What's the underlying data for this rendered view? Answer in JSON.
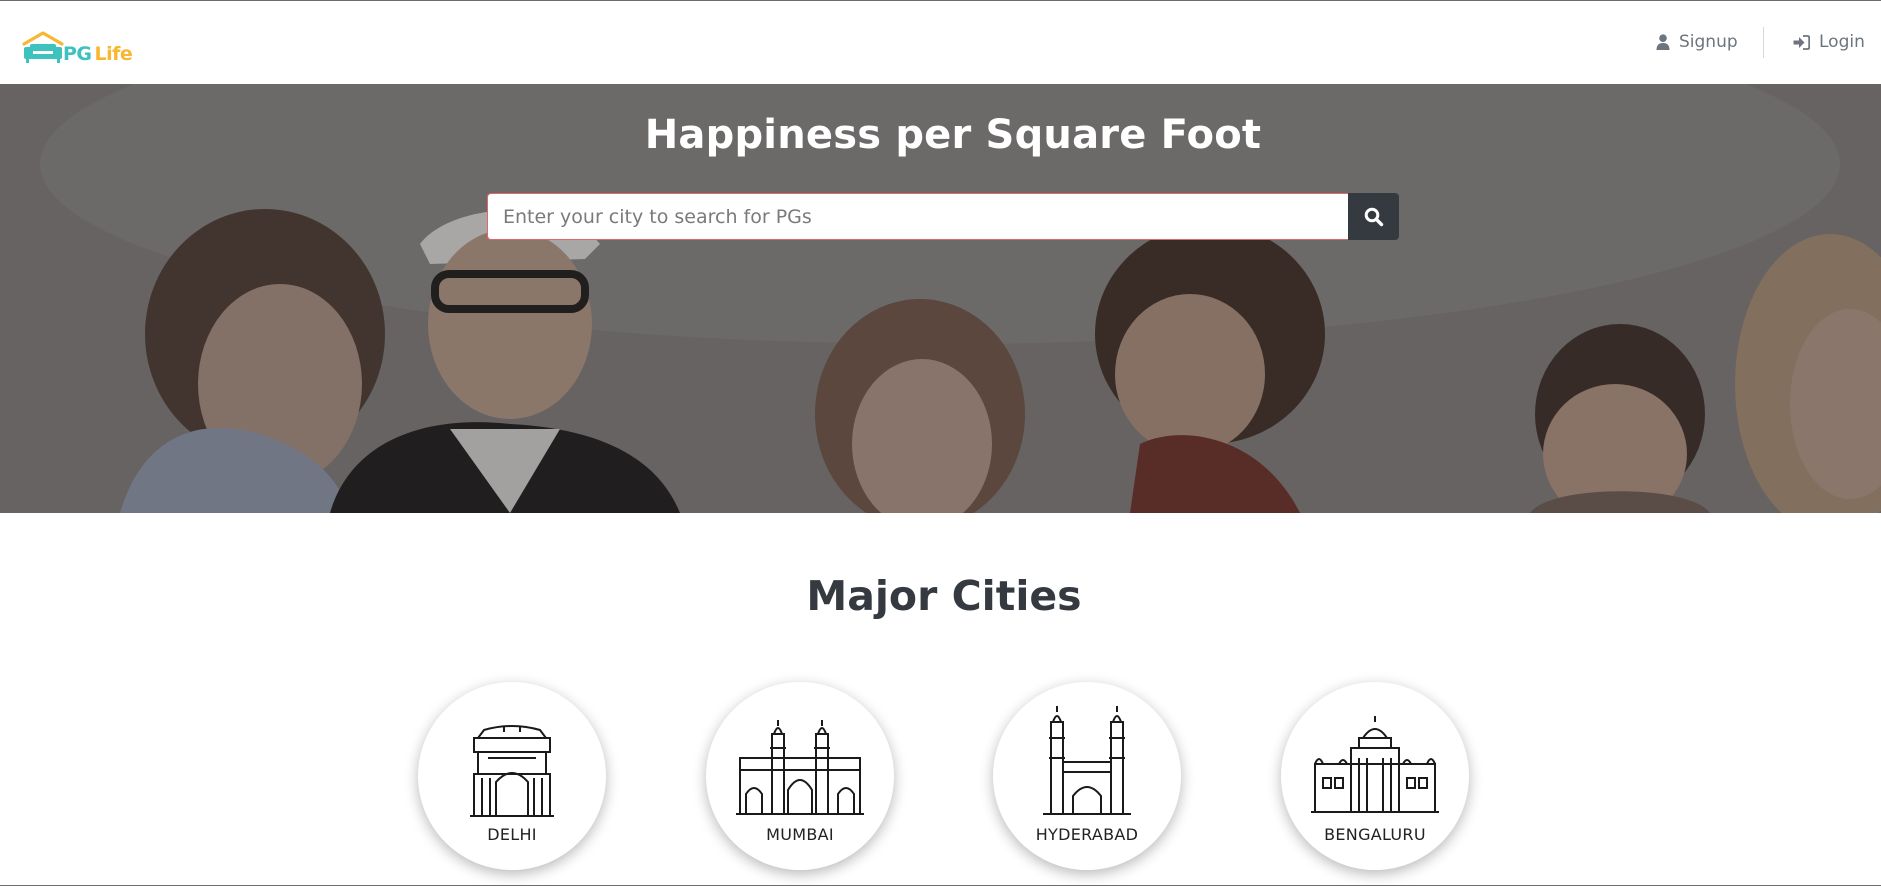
{
  "brand": {
    "name_part1": "PG",
    "name_part2": "Life",
    "icon": "house-sofa-logo"
  },
  "nav": {
    "signup_label": "Signup",
    "signup_icon": "user-icon",
    "login_label": "Login",
    "login_icon": "sign-in-icon"
  },
  "hero": {
    "title": "Happiness per Square Foot",
    "search_placeholder": "Enter your city to search for PGs",
    "search_value": "",
    "search_icon": "search-icon"
  },
  "cities_section": {
    "title": "Major Cities",
    "cities": [
      {
        "name": "DELHI",
        "icon": "india-gate-icon"
      },
      {
        "name": "MUMBAI",
        "icon": "gateway-of-india-icon"
      },
      {
        "name": "HYDERABAD",
        "icon": "charminar-icon"
      },
      {
        "name": "BENGALURU",
        "icon": "vidhana-soudha-icon"
      }
    ]
  },
  "colors": {
    "brand_teal": "#3ec2c0",
    "brand_yellow": "#f7b731",
    "dark_button": "#343a40",
    "nav_text": "#6c757d"
  }
}
